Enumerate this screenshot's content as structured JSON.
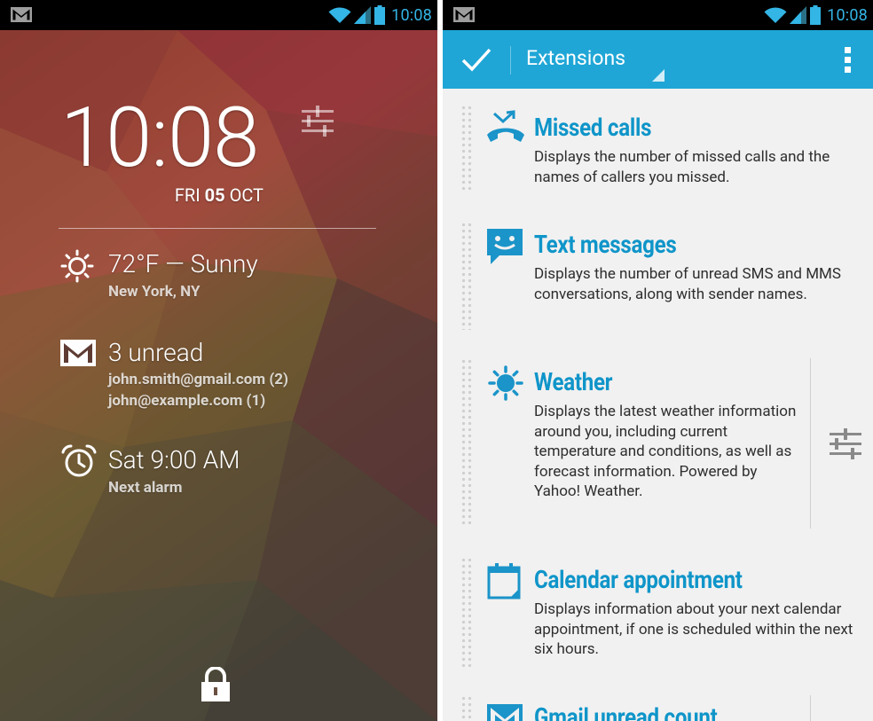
{
  "statusbar": {
    "time": "10:08",
    "icons": [
      "gmail-notification-icon",
      "wifi-icon",
      "cell-signal-icon",
      "battery-icon"
    ]
  },
  "lockscreen": {
    "clock_time": "10:08",
    "date_day": "FRI",
    "date_num": "05",
    "date_month": "OCT",
    "weather": {
      "title": "72°F — Sunny",
      "subtitle": "New York, NY",
      "icon": "sun-icon"
    },
    "gmail": {
      "title": "3 unread",
      "lines": [
        "john.smith@gmail.com (2)",
        "john@example.com (1)"
      ],
      "icon": "gmail-icon"
    },
    "alarm": {
      "title": "Sat 9:00 AM",
      "subtitle": "Next alarm",
      "icon": "alarm-clock-icon"
    },
    "lock_icon": "lock-icon"
  },
  "extensions_screen": {
    "title": "Extensions",
    "accent": "#1fa6d6",
    "title_color": "#0f95c9",
    "items": [
      {
        "title": "Missed calls",
        "description": "Displays the number of missed calls and the names of callers you missed.",
        "icon": "missed-call-icon"
      },
      {
        "title": "Text messages",
        "description": "Displays the number of unread SMS and MMS conversations, along with sender names.",
        "icon": "sms-icon"
      },
      {
        "title": "Weather",
        "description": "Displays the latest weather information around you, including current temperature and conditions, as well as forecast information. Powered by Yahoo! Weather.",
        "icon": "sun-icon",
        "has_settings": true
      },
      {
        "title": "Calendar appointment",
        "description": "Displays information about your next calendar appointment, if one is scheduled within the next six hours.",
        "icon": "calendar-icon"
      },
      {
        "title": "Gmail unread count",
        "description": "",
        "icon": "gmail-icon",
        "has_settings": true
      }
    ]
  }
}
